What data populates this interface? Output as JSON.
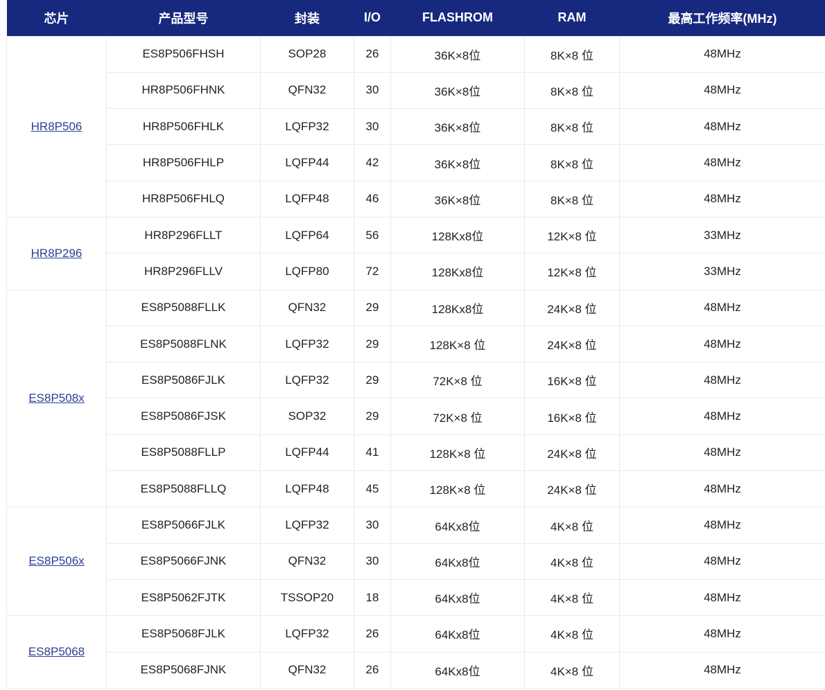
{
  "headers": [
    "芯片",
    "产品型号",
    "封装",
    "I/O",
    "FLASHROM",
    "RAM",
    "最高工作频率(MHz)"
  ],
  "groups": [
    {
      "chip": "HR8P506",
      "rows": [
        [
          "ES8P506FHSH",
          "SOP28",
          "26",
          "36K×8位",
          "8K×8 位",
          "48MHz"
        ],
        [
          "HR8P506FHNK",
          "QFN32",
          "30",
          "36K×8位",
          "8K×8 位",
          "48MHz"
        ],
        [
          "HR8P506FHLK",
          "LQFP32",
          "30",
          "36K×8位",
          "8K×8 位",
          "48MHz"
        ],
        [
          "HR8P506FHLP",
          "LQFP44",
          "42",
          "36K×8位",
          "8K×8 位",
          "48MHz"
        ],
        [
          "HR8P506FHLQ",
          "LQFP48",
          "46",
          "36K×8位",
          "8K×8 位",
          "48MHz"
        ]
      ]
    },
    {
      "chip": "HR8P296",
      "rows": [
        [
          "HR8P296FLLT",
          "LQFP64",
          "56",
          "128Kx8位",
          "12K×8 位",
          "33MHz"
        ],
        [
          "HR8P296FLLV",
          "LQFP80",
          "72",
          "128Kx8位",
          "12K×8 位",
          "33MHz"
        ]
      ]
    },
    {
      "chip": "ES8P508x",
      "rows": [
        [
          "ES8P5088FLLK",
          "QFN32",
          "29",
          "128Kx8位",
          "24K×8 位",
          "48MHz"
        ],
        [
          "ES8P5088FLNK",
          "LQFP32",
          "29",
          "128K×8 位",
          "24K×8 位",
          "48MHz"
        ],
        [
          "ES8P5086FJLK",
          "LQFP32",
          "29",
          "72K×8 位",
          "16K×8 位",
          "48MHz"
        ],
        [
          "ES8P5086FJSK",
          "SOP32",
          "29",
          "72K×8 位",
          "16K×8 位",
          "48MHz"
        ],
        [
          "ES8P5088FLLP",
          "LQFP44",
          "41",
          "128K×8 位",
          "24K×8 位",
          "48MHz"
        ],
        [
          "ES8P5088FLLQ",
          "LQFP48",
          "45",
          "128K×8 位",
          "24K×8 位",
          "48MHz"
        ]
      ]
    },
    {
      "chip": "ES8P506x",
      "rows": [
        [
          "ES8P5066FJLK",
          "LQFP32",
          "30",
          "64Kx8位",
          "4K×8 位",
          "48MHz"
        ],
        [
          "ES8P5066FJNK",
          "QFN32",
          "30",
          "64Kx8位",
          "4K×8 位",
          "48MHz"
        ],
        [
          "ES8P5062FJTK",
          "TSSOP20",
          "18",
          "64Kx8位",
          "4K×8 位",
          "48MHz"
        ]
      ]
    },
    {
      "chip": "ES8P5068",
      "rows": [
        [
          "ES8P5068FJLK",
          "LQFP32",
          "26",
          "64Kx8位",
          "4K×8 位",
          "48MHz"
        ],
        [
          "ES8P5068FJNK",
          "QFN32",
          "26",
          "64Kx8位",
          "4K×8 位",
          "48MHz"
        ]
      ]
    }
  ]
}
